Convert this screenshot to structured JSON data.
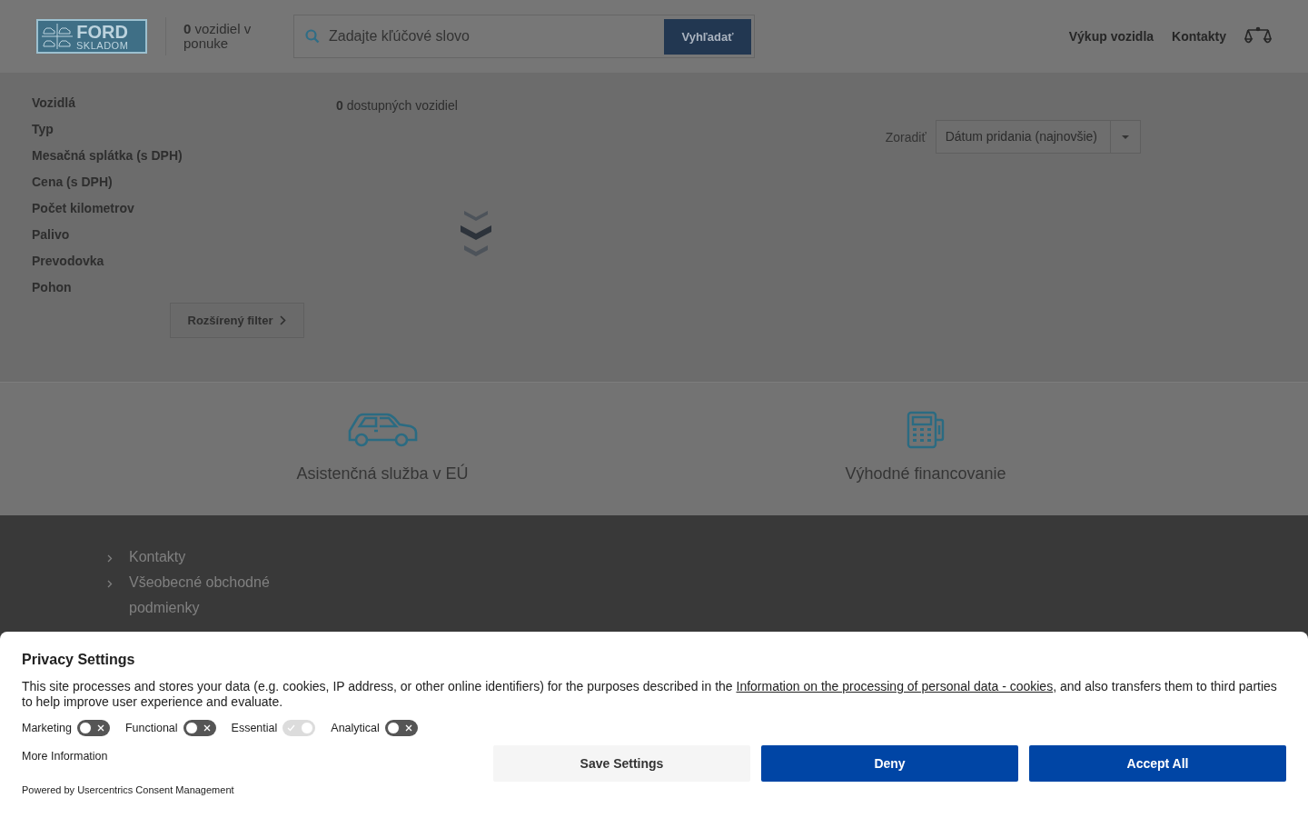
{
  "header": {
    "logo": {
      "brand": "FORD",
      "subtitle": "SKLADOM"
    },
    "stock_count": {
      "number": "0",
      "label": "vozidiel v ponuke"
    },
    "search": {
      "placeholder": "Zadajte kľúčové slovo",
      "button": "Vyhľadať"
    },
    "nav": [
      "Výkup vozidla",
      "Kontakty"
    ]
  },
  "filters": {
    "items": [
      "Vozidlá",
      "Typ",
      "Mesačná splátka (s DPH)",
      "Cena (s DPH)",
      "Počet kilometrov",
      "Palivo",
      "Prevodovka",
      "Pohon"
    ],
    "advanced_button": "Rozšírený filter"
  },
  "results": {
    "count": "0",
    "count_label": "dostupných vozidiel",
    "sort_label": "Zoradiť",
    "sort_value": "Dátum pridania (najnovšie)"
  },
  "features": [
    {
      "kind": "car",
      "label": "Asistenčná služba v EÚ"
    },
    {
      "kind": "calculator",
      "label": "Výhodné financovanie"
    }
  ],
  "footer": {
    "links": [
      "Kontakty",
      "Všeobecné obchodné podmienky"
    ]
  },
  "consent": {
    "title": "Privacy Settings",
    "text_before": "This site processes and stores your data (e.g. cookies, IP address, or other online identifiers) for the purposes described in the",
    "link": "Information on the processing of personal data - cookies",
    "text_after": ", and also transfers them to third parties to help improve user experience and evaluate.",
    "toggles": [
      {
        "label": "Marketing",
        "checked": false,
        "disabled": false
      },
      {
        "label": "Functional",
        "checked": false,
        "disabled": false
      },
      {
        "label": "Essential",
        "checked": true,
        "disabled": true
      },
      {
        "label": "Analytical",
        "checked": false,
        "disabled": false
      }
    ],
    "more_info": "More Information",
    "powered_by": "Powered by Usercentrics Consent Management",
    "buttons": [
      {
        "kind": "secondary",
        "label": "Save Settings"
      },
      {
        "kind": "primary",
        "label": "Deny"
      },
      {
        "kind": "primary",
        "label": "Accept All"
      }
    ]
  }
}
